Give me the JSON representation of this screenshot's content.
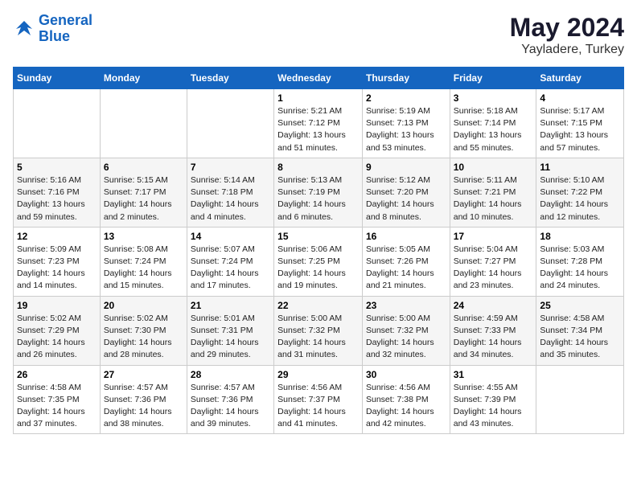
{
  "header": {
    "logo_line1": "General",
    "logo_line2": "Blue",
    "month": "May 2024",
    "location": "Yayladere, Turkey"
  },
  "days_of_week": [
    "Sunday",
    "Monday",
    "Tuesday",
    "Wednesday",
    "Thursday",
    "Friday",
    "Saturday"
  ],
  "weeks": [
    [
      {
        "num": "",
        "info": ""
      },
      {
        "num": "",
        "info": ""
      },
      {
        "num": "",
        "info": ""
      },
      {
        "num": "1",
        "info": "Sunrise: 5:21 AM\nSunset: 7:12 PM\nDaylight: 13 hours\nand 51 minutes."
      },
      {
        "num": "2",
        "info": "Sunrise: 5:19 AM\nSunset: 7:13 PM\nDaylight: 13 hours\nand 53 minutes."
      },
      {
        "num": "3",
        "info": "Sunrise: 5:18 AM\nSunset: 7:14 PM\nDaylight: 13 hours\nand 55 minutes."
      },
      {
        "num": "4",
        "info": "Sunrise: 5:17 AM\nSunset: 7:15 PM\nDaylight: 13 hours\nand 57 minutes."
      }
    ],
    [
      {
        "num": "5",
        "info": "Sunrise: 5:16 AM\nSunset: 7:16 PM\nDaylight: 13 hours\nand 59 minutes."
      },
      {
        "num": "6",
        "info": "Sunrise: 5:15 AM\nSunset: 7:17 PM\nDaylight: 14 hours\nand 2 minutes."
      },
      {
        "num": "7",
        "info": "Sunrise: 5:14 AM\nSunset: 7:18 PM\nDaylight: 14 hours\nand 4 minutes."
      },
      {
        "num": "8",
        "info": "Sunrise: 5:13 AM\nSunset: 7:19 PM\nDaylight: 14 hours\nand 6 minutes."
      },
      {
        "num": "9",
        "info": "Sunrise: 5:12 AM\nSunset: 7:20 PM\nDaylight: 14 hours\nand 8 minutes."
      },
      {
        "num": "10",
        "info": "Sunrise: 5:11 AM\nSunset: 7:21 PM\nDaylight: 14 hours\nand 10 minutes."
      },
      {
        "num": "11",
        "info": "Sunrise: 5:10 AM\nSunset: 7:22 PM\nDaylight: 14 hours\nand 12 minutes."
      }
    ],
    [
      {
        "num": "12",
        "info": "Sunrise: 5:09 AM\nSunset: 7:23 PM\nDaylight: 14 hours\nand 14 minutes."
      },
      {
        "num": "13",
        "info": "Sunrise: 5:08 AM\nSunset: 7:24 PM\nDaylight: 14 hours\nand 15 minutes."
      },
      {
        "num": "14",
        "info": "Sunrise: 5:07 AM\nSunset: 7:24 PM\nDaylight: 14 hours\nand 17 minutes."
      },
      {
        "num": "15",
        "info": "Sunrise: 5:06 AM\nSunset: 7:25 PM\nDaylight: 14 hours\nand 19 minutes."
      },
      {
        "num": "16",
        "info": "Sunrise: 5:05 AM\nSunset: 7:26 PM\nDaylight: 14 hours\nand 21 minutes."
      },
      {
        "num": "17",
        "info": "Sunrise: 5:04 AM\nSunset: 7:27 PM\nDaylight: 14 hours\nand 23 minutes."
      },
      {
        "num": "18",
        "info": "Sunrise: 5:03 AM\nSunset: 7:28 PM\nDaylight: 14 hours\nand 24 minutes."
      }
    ],
    [
      {
        "num": "19",
        "info": "Sunrise: 5:02 AM\nSunset: 7:29 PM\nDaylight: 14 hours\nand 26 minutes."
      },
      {
        "num": "20",
        "info": "Sunrise: 5:02 AM\nSunset: 7:30 PM\nDaylight: 14 hours\nand 28 minutes."
      },
      {
        "num": "21",
        "info": "Sunrise: 5:01 AM\nSunset: 7:31 PM\nDaylight: 14 hours\nand 29 minutes."
      },
      {
        "num": "22",
        "info": "Sunrise: 5:00 AM\nSunset: 7:32 PM\nDaylight: 14 hours\nand 31 minutes."
      },
      {
        "num": "23",
        "info": "Sunrise: 5:00 AM\nSunset: 7:32 PM\nDaylight: 14 hours\nand 32 minutes."
      },
      {
        "num": "24",
        "info": "Sunrise: 4:59 AM\nSunset: 7:33 PM\nDaylight: 14 hours\nand 34 minutes."
      },
      {
        "num": "25",
        "info": "Sunrise: 4:58 AM\nSunset: 7:34 PM\nDaylight: 14 hours\nand 35 minutes."
      }
    ],
    [
      {
        "num": "26",
        "info": "Sunrise: 4:58 AM\nSunset: 7:35 PM\nDaylight: 14 hours\nand 37 minutes."
      },
      {
        "num": "27",
        "info": "Sunrise: 4:57 AM\nSunset: 7:36 PM\nDaylight: 14 hours\nand 38 minutes."
      },
      {
        "num": "28",
        "info": "Sunrise: 4:57 AM\nSunset: 7:36 PM\nDaylight: 14 hours\nand 39 minutes."
      },
      {
        "num": "29",
        "info": "Sunrise: 4:56 AM\nSunset: 7:37 PM\nDaylight: 14 hours\nand 41 minutes."
      },
      {
        "num": "30",
        "info": "Sunrise: 4:56 AM\nSunset: 7:38 PM\nDaylight: 14 hours\nand 42 minutes."
      },
      {
        "num": "31",
        "info": "Sunrise: 4:55 AM\nSunset: 7:39 PM\nDaylight: 14 hours\nand 43 minutes."
      },
      {
        "num": "",
        "info": ""
      }
    ]
  ]
}
